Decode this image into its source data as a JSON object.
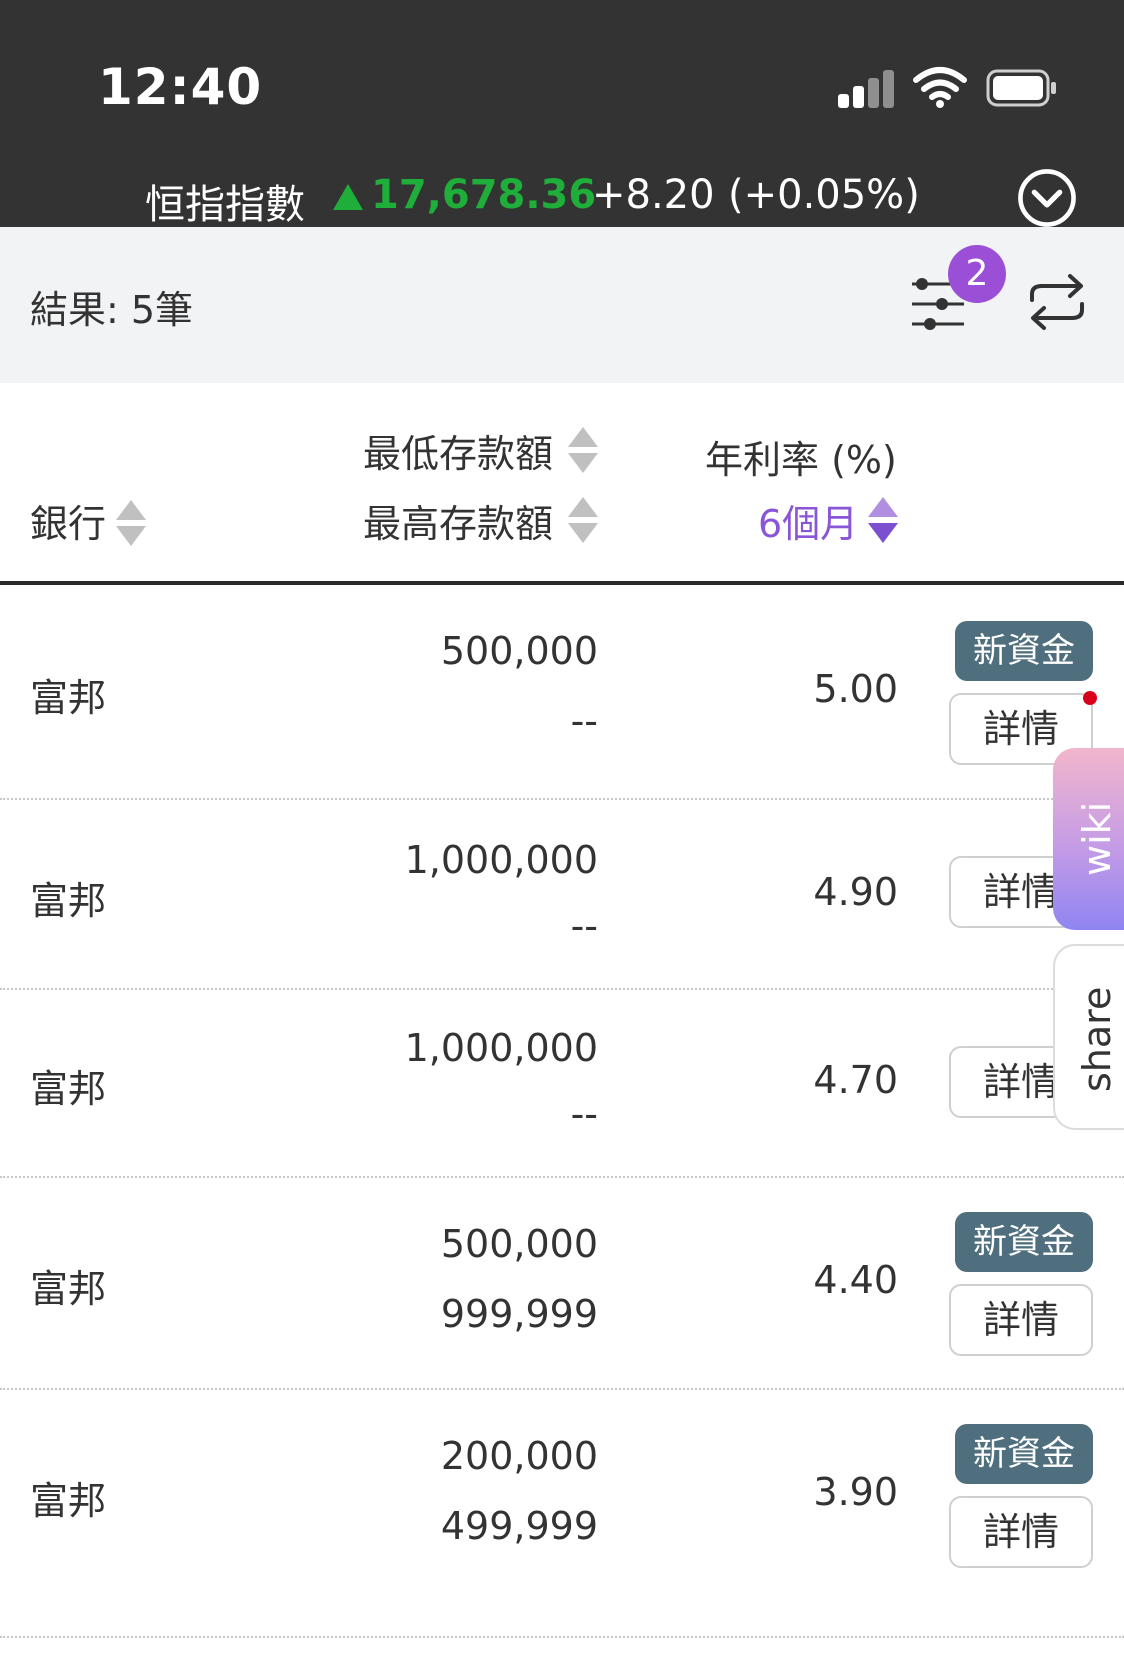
{
  "status_bar": {
    "time": "12:40"
  },
  "ticker": {
    "index_name": "恒指指數",
    "value": "17,678.36",
    "change": "+8.20",
    "change_pct": "(+0.05%)",
    "direction_icon": "triangle-up-icon",
    "up_color": "#1fae3a"
  },
  "results": {
    "label": "結果: 5筆",
    "filter_badge_count": "2"
  },
  "table_header": {
    "bank": "銀行",
    "min_deposit": "最低存款額",
    "max_deposit": "最高存款額",
    "annual_rate": "年利率 (%)",
    "period": "6個月"
  },
  "rows": [
    {
      "bank": "富邦",
      "min": "500,000",
      "max": "--",
      "rate": "5.00",
      "tag": "新資金",
      "detail": "詳情"
    },
    {
      "bank": "富邦",
      "min": "1,000,000",
      "max": "--",
      "rate": "4.90",
      "tag": "",
      "detail": "詳情"
    },
    {
      "bank": "富邦",
      "min": "1,000,000",
      "max": "--",
      "rate": "4.70",
      "tag": "",
      "detail": "詳情"
    },
    {
      "bank": "富邦",
      "min": "500,000",
      "max": "999,999",
      "rate": "4.40",
      "tag": "新資金",
      "detail": "詳情"
    },
    {
      "bank": "富邦",
      "min": "200,000",
      "max": "499,999",
      "rate": "3.90",
      "tag": "新資金",
      "detail": "詳情"
    }
  ],
  "side_tabs": {
    "wiki": "wiki",
    "share": "share"
  },
  "colors": {
    "accent_purple": "#9b4fd6",
    "tag_bg": "#4f6f7e",
    "header_bg": "#333333"
  }
}
